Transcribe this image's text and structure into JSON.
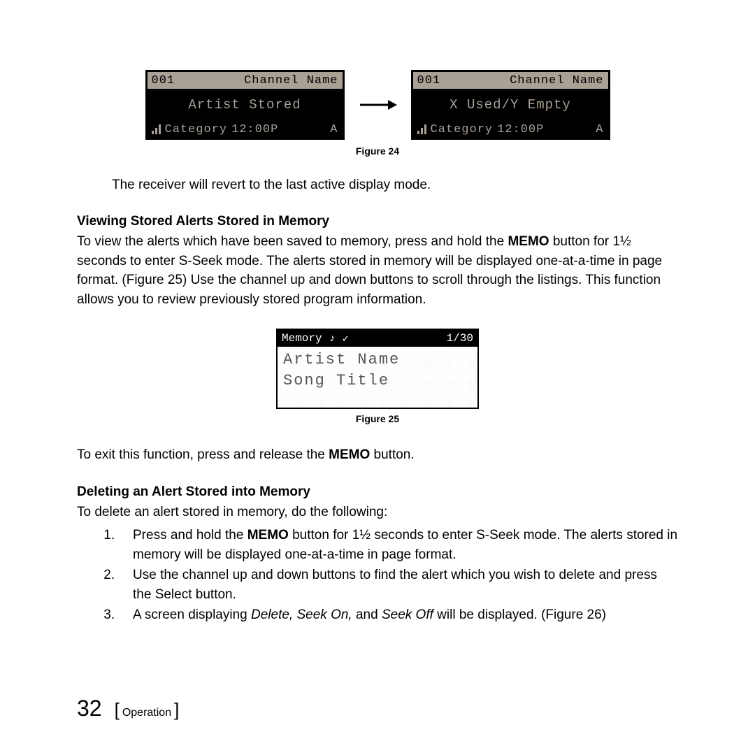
{
  "lcd1": {
    "top_left": "001",
    "top_right": "Channel Name",
    "mid": "Artist Stored",
    "bot_category": "Category",
    "bot_time": "12:00P",
    "bot_right": "A"
  },
  "lcd2": {
    "top_left": "001",
    "top_right": "Channel Name",
    "mid": "X Used/Y Empty",
    "bot_category": "Category",
    "bot_time": "12:00P",
    "bot_right": "A"
  },
  "fig24": "Figure 24",
  "para_revert": "The receiver will revert to the last active display mode.",
  "heading_viewing": "Viewing Stored Alerts Stored in Memory",
  "para_viewing_1": "To view the alerts which have been saved to memory, press and hold the ",
  "memo_label": "MEMO",
  "para_viewing_2": " button for 1½ seconds to enter S-Seek mode. The alerts stored in memory will be displayed one-at-a-time in page format. (Figure 25) Use the channel up and down buttons to scroll through the listings. This function allows you to review previously stored program information.",
  "memlcd": {
    "top_left": "Memory",
    "top_right": "1/30",
    "line1": "Artist Name",
    "line2": "Song Title"
  },
  "fig25": "Figure 25",
  "para_exit_1": "To exit this function, press and release the ",
  "para_exit_2": " button.",
  "heading_delete": "Deleting an Alert Stored into Memory",
  "para_delete_intro": "To delete an alert stored in memory, do the following:",
  "step1_a": "Press and hold the ",
  "step1_b": " button for 1½ seconds to enter S-Seek mode. The alerts stored in memory will be displayed one-at-a-time in page format.",
  "step2": "Use the channel up and down buttons to find the alert which you wish to delete and press the Select button.",
  "step3_a": "A screen displaying ",
  "step3_em": "Delete, Seek On,",
  "step3_b": " and ",
  "step3_em2": "Seek Off",
  "step3_c": " will be displayed. (Figure 26)",
  "page_number": "32",
  "footer_label": "Operation"
}
